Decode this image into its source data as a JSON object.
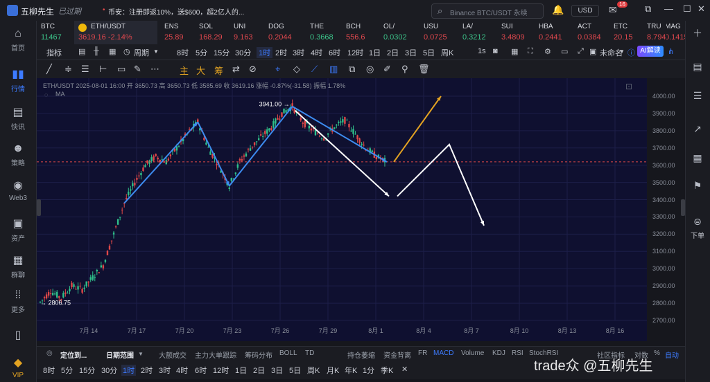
{
  "app": {
    "name": "五柳先生",
    "login_status": "已过期"
  },
  "news": {
    "text": "币安：注册即返10%，送$600，超2亿人的..."
  },
  "search": {
    "placeholder": "Binance BTC/USDT 永续"
  },
  "currency": "USD",
  "mail_badge": "16",
  "sidebar": [
    {
      "label": "首页",
      "icon": "home-icon"
    },
    {
      "label": "行情",
      "icon": "chart-icon",
      "active": true
    },
    {
      "label": "快讯",
      "icon": "news-icon"
    },
    {
      "label": "策略",
      "icon": "robot-icon"
    },
    {
      "label": "Web3",
      "icon": "web3-icon"
    },
    {
      "label": "资产",
      "icon": "wallet-icon"
    },
    {
      "label": "群聊",
      "icon": "chat-icon"
    },
    {
      "label": "更多",
      "icon": "more-icon"
    },
    {
      "label": "VIP",
      "icon": "vip-icon"
    }
  ],
  "tickers": [
    {
      "sym": "BTC",
      "price": "11467",
      "up": true
    },
    {
      "sym": "ETH/USDT",
      "price": "3619.16  -2.14%",
      "active": true
    },
    {
      "sym": "ENS",
      "price": "25.89"
    },
    {
      "sym": "SOL",
      "price": "168.29"
    },
    {
      "sym": "UNI",
      "price": "9.163"
    },
    {
      "sym": "DOG",
      "price": "0.2044"
    },
    {
      "sym": "THE",
      "price": "0.3668",
      "up": true
    },
    {
      "sym": "BCH",
      "price": "556.6"
    },
    {
      "sym": "OL/",
      "price": "0.0302",
      "up": true
    },
    {
      "sym": "USU",
      "price": "0.0725"
    },
    {
      "sym": "LA/",
      "price": "0.3212",
      "up": true
    },
    {
      "sym": "SUI",
      "price": "3.4809"
    },
    {
      "sym": "HBA",
      "price": "0.2441"
    },
    {
      "sym": "ACT",
      "price": "0.0384"
    },
    {
      "sym": "ETC",
      "price": "20.15"
    },
    {
      "sym": "TRU",
      "price": "8.794"
    },
    {
      "sym": "MAG",
      "price": "0.1415"
    }
  ],
  "toolbar1": {
    "indicators": "指标",
    "period": "周期",
    "timeframes": [
      "8时",
      "5分",
      "15分",
      "30分",
      "1时",
      "2时",
      "3时",
      "4时",
      "6时",
      "12时",
      "1日",
      "2日",
      "3日",
      "5日",
      "周K"
    ],
    "selected_tf": "1时",
    "interval": "1s",
    "untitled": "未命名",
    "ai": "AI解读"
  },
  "toolbar2": {
    "main": "主",
    "big": "大",
    "chip": "筹"
  },
  "chart": {
    "ohlc": "ETH/USDT  2025-08-01 16:00  开 3650.73  高 3650.73  低 3585.69  收 3619.16  涨幅 -0.87%(-31.58)  振幅 1.78%",
    "ma_label": "MA",
    "high_label": "3941.00",
    "low_label": "2806.75",
    "price_ticks": [
      "4000.00",
      "3900.00",
      "3800.00",
      "3700.00",
      "3600.00",
      "3500.00",
      "3400.00",
      "3300.00",
      "3200.00",
      "3100.00",
      "3000.00",
      "2900.00",
      "2800.00",
      "2700.00"
    ],
    "date_ticks": [
      "7月 14",
      "7月 17",
      "7月 20",
      "7月 23",
      "7月 26",
      "7月 29",
      "8月 1",
      "8月 4",
      "8月 7",
      "8月 10",
      "8月 13",
      "8月 16"
    ]
  },
  "chart_data": {
    "type": "line",
    "title": "",
    "xlabel": "",
    "ylabel": "",
    "ylim": [
      2700,
      4000
    ],
    "current_price": 3619.16,
    "series": [
      {
        "name": "",
        "values": [
          2806,
          2870,
          2830,
          2900,
          2880,
          2950,
          3020,
          3200,
          3380,
          3500,
          3600,
          3650,
          3620,
          3700,
          3780,
          3850,
          3700,
          3600,
          3480,
          3620,
          3700,
          3760,
          3820,
          3900,
          3941,
          3850,
          3800,
          3760,
          3820,
          3860,
          3780,
          3700,
          3650,
          3619
        ]
      }
    ]
  },
  "indicators_row": {
    "position": "定位到...",
    "date_range": "日期范围",
    "items": [
      "大额成交",
      "主力大单跟踪",
      "筹码分布",
      "BOLL",
      "TD",
      "持仓萎缩",
      "资金背离",
      "FR",
      "MACD",
      "Volume",
      "KDJ",
      "RSI",
      "StochRSI"
    ],
    "selected": "MACD",
    "community": "社区指标",
    "log": "对数",
    "pct": "%",
    "auto": "自动"
  },
  "tf_row": {
    "items": [
      "8时",
      "5分",
      "15分",
      "30分",
      "1时",
      "2时",
      "3时",
      "4时",
      "6时",
      "12时",
      "1日",
      "2日",
      "3日",
      "5日",
      "周K",
      "月K",
      "年K",
      "1分",
      "季K"
    ],
    "selected": "1时"
  },
  "watermark": "trade众 @五柳先生",
  "right_sidebar": {
    "label": "下单"
  }
}
